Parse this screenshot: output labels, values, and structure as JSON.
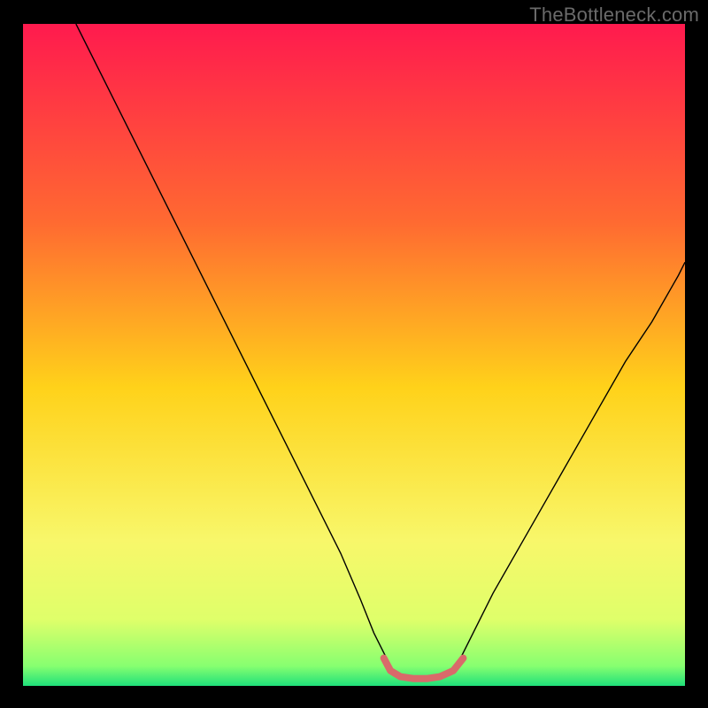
{
  "watermark": {
    "text": "TheBottleneck.com"
  },
  "chart_data": {
    "type": "line",
    "title": "",
    "xlabel": "",
    "ylabel": "",
    "xlim": [
      0,
      100
    ],
    "ylim": [
      0,
      100
    ],
    "grid": false,
    "legend": false,
    "background_gradient_stops": [
      {
        "pos": 0.0,
        "color": "#ff1a4e"
      },
      {
        "pos": 0.3,
        "color": "#ff6a31"
      },
      {
        "pos": 0.55,
        "color": "#ffd21a"
      },
      {
        "pos": 0.78,
        "color": "#f8f76a"
      },
      {
        "pos": 0.9,
        "color": "#dfff6a"
      },
      {
        "pos": 0.97,
        "color": "#87ff70"
      },
      {
        "pos": 1.0,
        "color": "#1fe07a"
      }
    ],
    "series": [
      {
        "name": "bottleneck-curve-left",
        "stroke": "#000000",
        "stroke_width": 1.4,
        "x": [
          8,
          12,
          16,
          20,
          24,
          28,
          32,
          36,
          40,
          44,
          48,
          51,
          53,
          55
        ],
        "y": [
          100,
          92,
          84,
          76,
          68,
          60,
          52,
          44,
          36,
          28,
          20,
          13,
          8,
          4
        ]
      },
      {
        "name": "bottleneck-curve-right",
        "stroke": "#000000",
        "stroke_width": 1.4,
        "x": [
          66,
          68,
          71,
          75,
          79,
          83,
          87,
          91,
          95,
          99,
          100
        ],
        "y": [
          4,
          8,
          14,
          21,
          28,
          35,
          42,
          49,
          55,
          62,
          64
        ]
      },
      {
        "name": "minimum-band",
        "stroke": "#d96a6a",
        "stroke_width": 8,
        "linecap": "round",
        "x": [
          54.5,
          55.5,
          57,
          59,
          61,
          63,
          65,
          66.5
        ],
        "y": [
          4.2,
          2.3,
          1.4,
          1.1,
          1.1,
          1.4,
          2.3,
          4.2
        ]
      }
    ]
  }
}
